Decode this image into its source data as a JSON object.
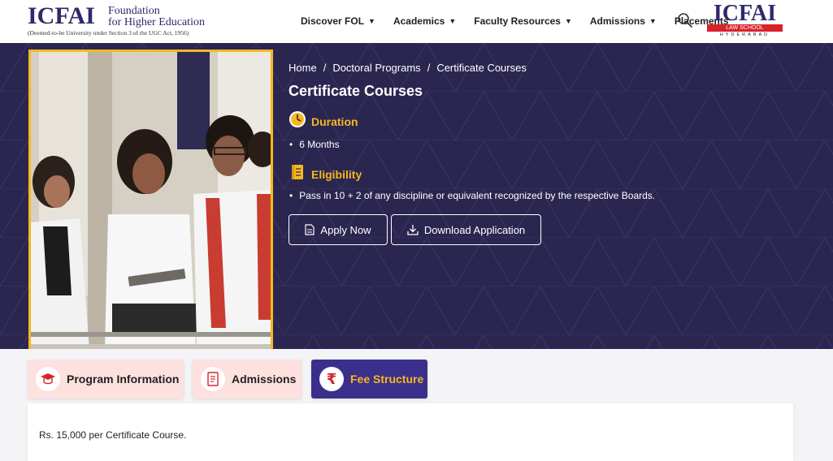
{
  "header": {
    "logo": {
      "main": "ICFAI",
      "line1": "Foundation",
      "line2": "for Higher Education",
      "tagline": "(Deemed-to-be University under Section 3 of the UGC Act, 1956)"
    },
    "nav": [
      {
        "label": "Discover FOL",
        "has_caret": true
      },
      {
        "label": "Academics",
        "has_caret": true
      },
      {
        "label": "Faculty Resources",
        "has_caret": true
      },
      {
        "label": "Admissions",
        "has_caret": true
      },
      {
        "label": "Placements",
        "has_caret": false
      }
    ],
    "search_icon": "search-icon",
    "law_logo": {
      "main": "ICFAI",
      "box": "LAW SCHOOL",
      "city": "HYDERABAD"
    }
  },
  "banner": {
    "breadcrumb": [
      "Home",
      "Doctoral Programs",
      "Certificate Courses"
    ],
    "title": "Certificate Courses",
    "duration": {
      "label": "Duration",
      "icon": "clock-icon",
      "value": "6 Months"
    },
    "eligibility": {
      "label": "Eligibility",
      "icon": "notebook-icon",
      "value": "Pass in 10 + 2 of any discipline or equivalent recognized by the respective Boards."
    },
    "buttons": {
      "apply": "Apply Now",
      "download": "Download Application"
    }
  },
  "tabs": [
    {
      "label": "Program Information",
      "icon": "graduation-cap-icon",
      "active": false
    },
    {
      "label": "Admissions",
      "icon": "form-icon",
      "active": false
    },
    {
      "label": "Fee Structure",
      "icon": "rupee-icon",
      "active": true
    }
  ],
  "content": {
    "fee_text": "Rs. 15,000 per Certificate Course."
  },
  "colors": {
    "brand_navy": "#2d2a6b",
    "banner_bg": "#2b2650",
    "accent_gold": "#f5b81f",
    "tab_active": "#3b2f8c",
    "tab_pink": "#fce1df",
    "law_red": "#d8232a"
  }
}
